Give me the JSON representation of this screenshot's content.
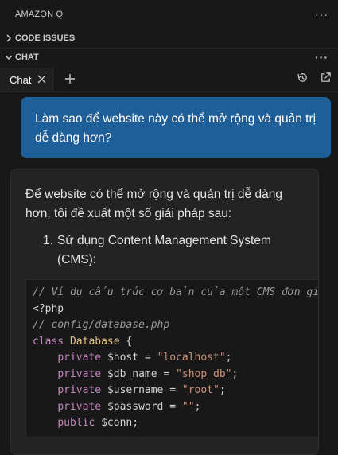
{
  "panel": {
    "title": "AMAZON Q"
  },
  "sections": {
    "code_issues": "CODE ISSUES",
    "chat": "CHAT"
  },
  "tabs": [
    {
      "label": "Chat"
    }
  ],
  "icons": {
    "more": "ellipsis-icon",
    "close": "close-icon",
    "add": "plus-icon",
    "history": "history-icon",
    "open": "open-external-icon",
    "collapsed": "chevron-right-icon",
    "expanded": "chevron-down-icon"
  },
  "colors": {
    "user_bubble": "#1e5e99",
    "background": "#181818",
    "answer_card": "#232323"
  },
  "chat": {
    "user_message": "Làm sao để website này có thể mở rộng và quản trị dễ dàng hơn?",
    "answer_intro": "Để website có thể mở rộng và quản trị dễ dàng hơn, tôi đề xuất một số giải pháp sau:",
    "list_item_number": "1.",
    "list_item_text": "Sử dụng Content Management System (CMS):",
    "code": {
      "line1": "// Ví dụ cấu trúc cơ bản của một CMS đơn giản",
      "line2": "<?php",
      "line3": "// config/database.php",
      "line4_kw": "class",
      "line4_name": "Database",
      "line4_brace": " {",
      "props": [
        {
          "kw": "private",
          "var": "$host",
          "op": " = ",
          "val": "\"localhost\"",
          "end": ";"
        },
        {
          "kw": "private",
          "var": "$db_name",
          "op": " = ",
          "val": "\"shop_db\"",
          "end": ";"
        },
        {
          "kw": "private",
          "var": "$username",
          "op": " = ",
          "val": "\"root\"",
          "end": ";"
        },
        {
          "kw": "private",
          "var": "$password",
          "op": " = ",
          "val": "\"\"",
          "end": ";"
        },
        {
          "kw": "public",
          "var": "$conn",
          "op": "",
          "val": "",
          "end": ";"
        }
      ]
    }
  }
}
